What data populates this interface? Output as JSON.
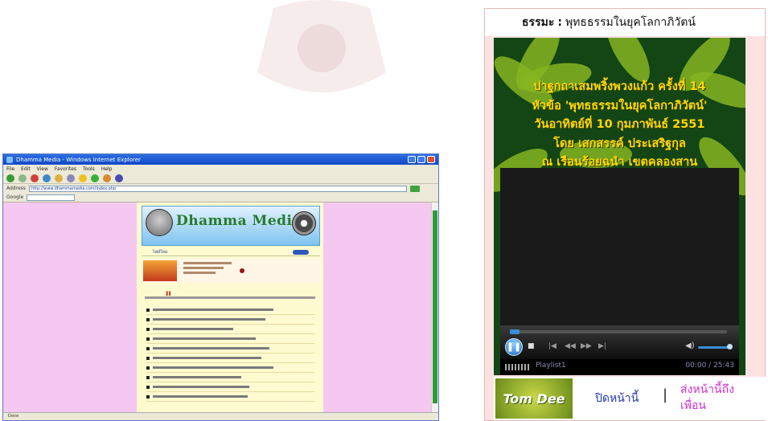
{
  "browser": {
    "title": "Dhamma Media - Windows Internet Explorer",
    "menu": [
      "File",
      "Edit",
      "View",
      "Favorites",
      "Tools",
      "Help"
    ],
    "address_label": "Address",
    "address_url": "http://www.dhammamedia.com/index.php",
    "go_label": "Go",
    "google_label": "Google",
    "status_text": "Done",
    "site": {
      "title": "Dhamma Media",
      "nav_label": "ไฟล์ใหม่"
    }
  },
  "widget": {
    "header_label": "ธรรมะ",
    "header_separator": ":",
    "header_topic": "พุทธธรรมในยุคโลกาภิวัตน์",
    "video_text_lines": [
      "ปาฐกถาเสมพริ้งพวงแก้ว ครั้งที่ 14",
      "หัวข้อ 'พุทธธรรมในยุคโลกาภิวัตน์'",
      "วันอาทิตย์ที่ 10 กุมภาพันธ์ 2551",
      "โดย เสกสรรค์ ประเสริฐกุล",
      "ณ เรือนร้อยฉนำ เขตคลองสาน"
    ],
    "playlist_label": "Playlist1",
    "time_display": "00:00 / 25:43",
    "logo_text": "Tom Dee",
    "close_link": "ปิดหน้านี้",
    "link_separator": "|",
    "share_link": "ส่งหน้านี้ถึงเพื่อน"
  },
  "colors": {
    "player_bg": "#134614",
    "video_text": "#ffd800",
    "viewport_bg": "#f4c8f0",
    "close_link": "#2438b8",
    "share_link": "#d12fd1"
  }
}
